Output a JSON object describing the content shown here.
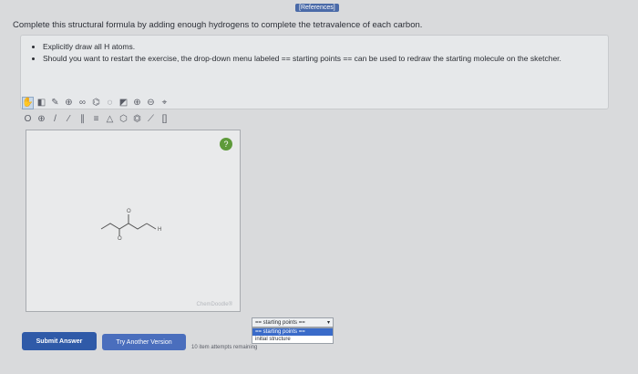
{
  "references_label": "[References]",
  "prompt": "Complete this structural formula by adding enough hydrogens to complete the tetravalence of each carbon.",
  "instructions": [
    "Explicitly draw all H atoms.",
    "Should you want to restart the exercise, the drop-down menu labeled == starting points == can be used to redraw the starting molecule on the sketcher."
  ],
  "sketcher": {
    "help_label": "?",
    "logo_text": "ChemDoodle®",
    "molecule_labels": [
      "O",
      "H",
      "O"
    ],
    "toolbar_row1_icons": [
      "hand-icon",
      "eraser-icon",
      "pencil-icon",
      "atom-icon",
      "rings-icon",
      "structure-icon",
      "lasso-icon",
      "clean-icon",
      "zoom-in-icon",
      "zoom-out-icon",
      "template-icon"
    ],
    "toolbar_row2_icons": [
      "label-icon",
      "plus-icon",
      "single-bond-icon",
      "wedge-bond-icon",
      "double-bond-icon",
      "triple-bond-icon",
      "ring3-icon",
      "ring6-icon",
      "benzene-icon",
      "chain-icon",
      "brackets-icon"
    ]
  },
  "dropdown": {
    "current": "== starting points ==",
    "options": [
      "== starting points ==",
      "initial structure"
    ]
  },
  "buttons": {
    "submit": "Submit Answer",
    "retry": "Try Another Version"
  },
  "attempts_text": "10 item attempts remaining"
}
